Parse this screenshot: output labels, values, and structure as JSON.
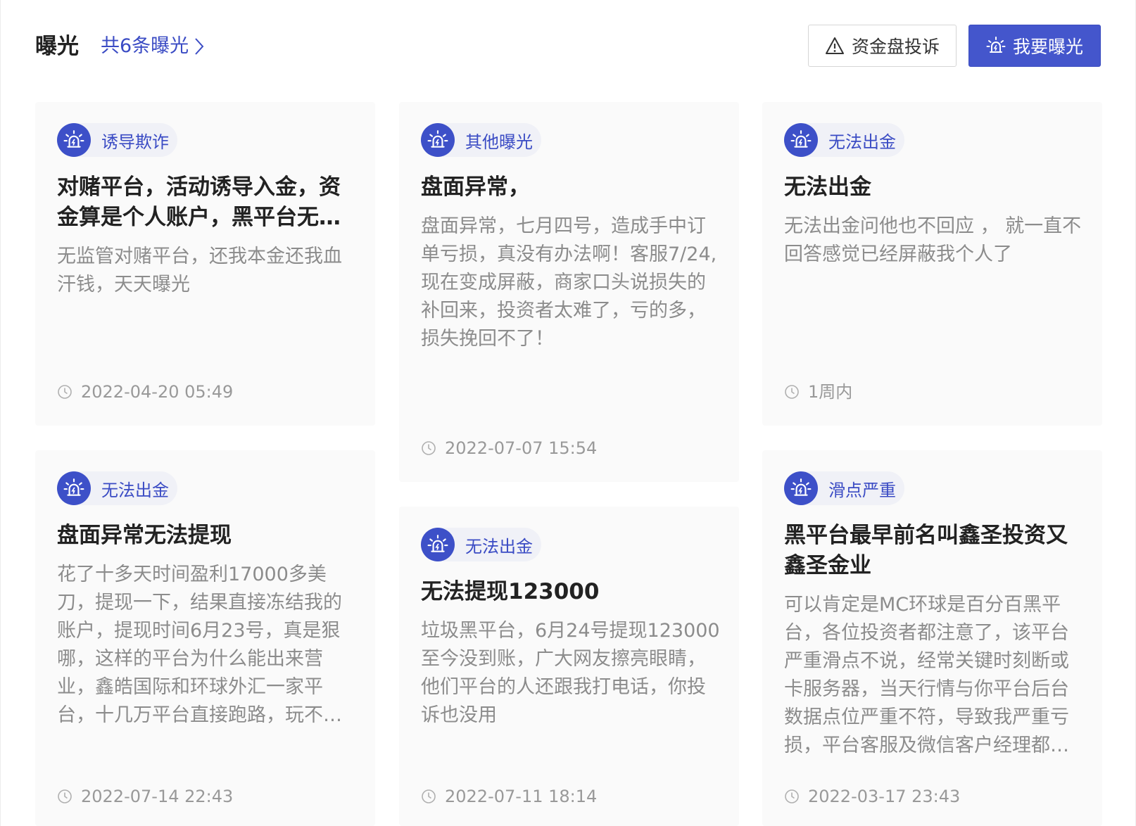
{
  "header": {
    "title": "曝光",
    "count_link": "共6条曝光",
    "complaint_button": "资金盘投诉",
    "expose_button": "我要曝光"
  },
  "colors": {
    "accent": "#3d50c8",
    "card_bg": "#fafafa",
    "tag_bg": "#f0f1f7"
  },
  "icons": {
    "tag": "alarm-siren-icon",
    "time": "clock-icon",
    "complaint": "warning-triangle-icon",
    "expose": "alarm-siren-icon",
    "more": "chevron-right-icon"
  },
  "cards": [
    {
      "tag": "诱导欺诈",
      "title": "对赌平台，活动诱导入金，资金算是个人账户，黑平台无法出金",
      "body": "无监管对赌平台，还我本金还我血汗钱，天天曝光",
      "time": "2022-04-20 05:49"
    },
    {
      "tag": "其他曝光",
      "title": "盘面异常，",
      "body": "盘面异常，七月四号，造成手中订单亏损，真没有办法啊！客服7/24,现在变成屏蔽，商家口头说损失的补回来，投资者太难了，亏的多，损失挽回不了！",
      "time": "2022-07-07 15:54"
    },
    {
      "tag": "无法出金",
      "title": "无法出金",
      "body": "无法出金问他也不回应 ， 就一直不回答感觉已经屏蔽我个人了",
      "time": "1周内"
    },
    {
      "tag": "无法出金",
      "title": "盘面异常无法提现",
      "body": "花了十多天时间盈利17000多美刀，提现一下，结果直接冻结我的账户，提现时间6月23号，真是狠哪，这样的平台为什么能出来营业，鑫皓国际和环球外汇一家平台，十几万平台直接跑路，玩不起就别玩",
      "time": "2022-07-14 22:43"
    },
    {
      "tag": "无法出金",
      "title": "无法提现123000",
      "body": "垃圾黑平台，6月24号提现123000至今没到账，广大网友擦亮眼睛，他们平台的人还跟我打电话，你投诉也没用",
      "time": "2022-07-11 18:14"
    },
    {
      "tag": "滑点严重",
      "title": "黑平台最早前名叫鑫圣投资又鑫圣金业",
      "body": "可以肯定是MC环球是百分百黑平台，各位投资者都注意了，该平台严重滑点不说，经常关键时刻断或卡服务器，当天行情与你平台后台数据点位严重不符，导致我严重亏损，平台客服及微信客户经理都不理睬",
      "time": "2022-03-17 23:43"
    }
  ]
}
